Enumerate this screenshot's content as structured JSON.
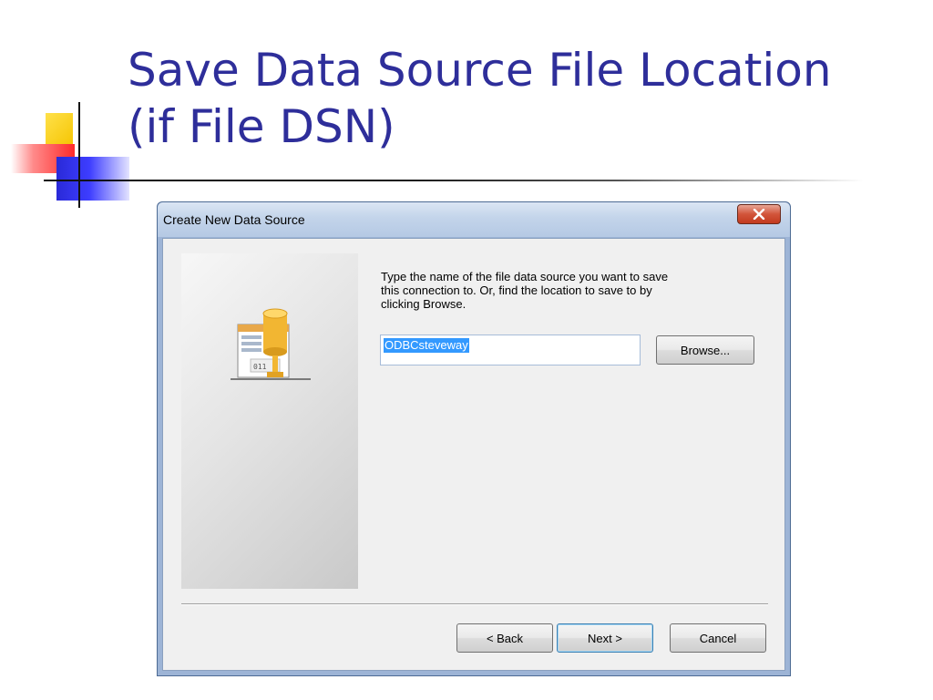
{
  "slide": {
    "title_line1": "Save Data Source File Location",
    "title_line2": "(if File DSN)"
  },
  "dialog": {
    "title": "Create New Data Source",
    "close_icon": "close-x-icon",
    "instruction_line1": "Type the name of the file data source you want to save",
    "instruction_line2": "this connection to.  Or, find the location to save to by",
    "instruction_line3": "clicking Browse.",
    "file_input_value": "ODBCsteveway",
    "browse_label": "Browse...",
    "back_label": "< Back",
    "next_label": "Next >",
    "cancel_label": "Cancel",
    "wizard_icon": "database-file-icon"
  },
  "colors": {
    "title": "#2e2e9a",
    "selection": "#3399ff",
    "close_button": "#c23a1f"
  }
}
